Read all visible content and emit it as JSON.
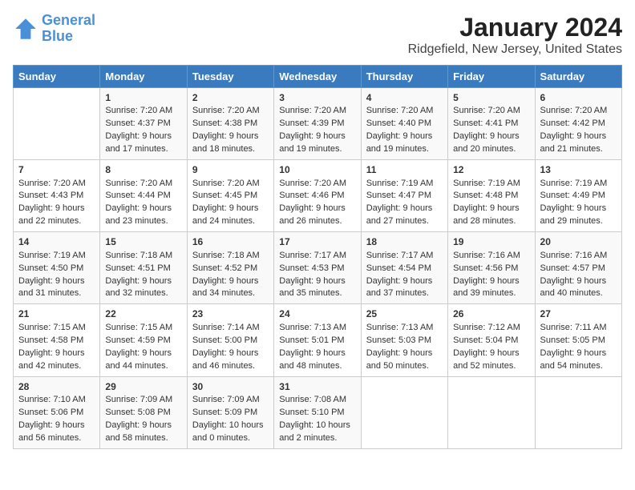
{
  "header": {
    "logo_line1": "General",
    "logo_line2": "Blue",
    "title": "January 2024",
    "subtitle": "Ridgefield, New Jersey, United States"
  },
  "days_of_week": [
    "Sunday",
    "Monday",
    "Tuesday",
    "Wednesday",
    "Thursday",
    "Friday",
    "Saturday"
  ],
  "weeks": [
    [
      {
        "num": "",
        "sunrise": "",
        "sunset": "",
        "daylight": ""
      },
      {
        "num": "1",
        "sunrise": "Sunrise: 7:20 AM",
        "sunset": "Sunset: 4:37 PM",
        "daylight": "Daylight: 9 hours and 17 minutes."
      },
      {
        "num": "2",
        "sunrise": "Sunrise: 7:20 AM",
        "sunset": "Sunset: 4:38 PM",
        "daylight": "Daylight: 9 hours and 18 minutes."
      },
      {
        "num": "3",
        "sunrise": "Sunrise: 7:20 AM",
        "sunset": "Sunset: 4:39 PM",
        "daylight": "Daylight: 9 hours and 19 minutes."
      },
      {
        "num": "4",
        "sunrise": "Sunrise: 7:20 AM",
        "sunset": "Sunset: 4:40 PM",
        "daylight": "Daylight: 9 hours and 19 minutes."
      },
      {
        "num": "5",
        "sunrise": "Sunrise: 7:20 AM",
        "sunset": "Sunset: 4:41 PM",
        "daylight": "Daylight: 9 hours and 20 minutes."
      },
      {
        "num": "6",
        "sunrise": "Sunrise: 7:20 AM",
        "sunset": "Sunset: 4:42 PM",
        "daylight": "Daylight: 9 hours and 21 minutes."
      }
    ],
    [
      {
        "num": "7",
        "sunrise": "Sunrise: 7:20 AM",
        "sunset": "Sunset: 4:43 PM",
        "daylight": "Daylight: 9 hours and 22 minutes."
      },
      {
        "num": "8",
        "sunrise": "Sunrise: 7:20 AM",
        "sunset": "Sunset: 4:44 PM",
        "daylight": "Daylight: 9 hours and 23 minutes."
      },
      {
        "num": "9",
        "sunrise": "Sunrise: 7:20 AM",
        "sunset": "Sunset: 4:45 PM",
        "daylight": "Daylight: 9 hours and 24 minutes."
      },
      {
        "num": "10",
        "sunrise": "Sunrise: 7:20 AM",
        "sunset": "Sunset: 4:46 PM",
        "daylight": "Daylight: 9 hours and 26 minutes."
      },
      {
        "num": "11",
        "sunrise": "Sunrise: 7:19 AM",
        "sunset": "Sunset: 4:47 PM",
        "daylight": "Daylight: 9 hours and 27 minutes."
      },
      {
        "num": "12",
        "sunrise": "Sunrise: 7:19 AM",
        "sunset": "Sunset: 4:48 PM",
        "daylight": "Daylight: 9 hours and 28 minutes."
      },
      {
        "num": "13",
        "sunrise": "Sunrise: 7:19 AM",
        "sunset": "Sunset: 4:49 PM",
        "daylight": "Daylight: 9 hours and 29 minutes."
      }
    ],
    [
      {
        "num": "14",
        "sunrise": "Sunrise: 7:19 AM",
        "sunset": "Sunset: 4:50 PM",
        "daylight": "Daylight: 9 hours and 31 minutes."
      },
      {
        "num": "15",
        "sunrise": "Sunrise: 7:18 AM",
        "sunset": "Sunset: 4:51 PM",
        "daylight": "Daylight: 9 hours and 32 minutes."
      },
      {
        "num": "16",
        "sunrise": "Sunrise: 7:18 AM",
        "sunset": "Sunset: 4:52 PM",
        "daylight": "Daylight: 9 hours and 34 minutes."
      },
      {
        "num": "17",
        "sunrise": "Sunrise: 7:17 AM",
        "sunset": "Sunset: 4:53 PM",
        "daylight": "Daylight: 9 hours and 35 minutes."
      },
      {
        "num": "18",
        "sunrise": "Sunrise: 7:17 AM",
        "sunset": "Sunset: 4:54 PM",
        "daylight": "Daylight: 9 hours and 37 minutes."
      },
      {
        "num": "19",
        "sunrise": "Sunrise: 7:16 AM",
        "sunset": "Sunset: 4:56 PM",
        "daylight": "Daylight: 9 hours and 39 minutes."
      },
      {
        "num": "20",
        "sunrise": "Sunrise: 7:16 AM",
        "sunset": "Sunset: 4:57 PM",
        "daylight": "Daylight: 9 hours and 40 minutes."
      }
    ],
    [
      {
        "num": "21",
        "sunrise": "Sunrise: 7:15 AM",
        "sunset": "Sunset: 4:58 PM",
        "daylight": "Daylight: 9 hours and 42 minutes."
      },
      {
        "num": "22",
        "sunrise": "Sunrise: 7:15 AM",
        "sunset": "Sunset: 4:59 PM",
        "daylight": "Daylight: 9 hours and 44 minutes."
      },
      {
        "num": "23",
        "sunrise": "Sunrise: 7:14 AM",
        "sunset": "Sunset: 5:00 PM",
        "daylight": "Daylight: 9 hours and 46 minutes."
      },
      {
        "num": "24",
        "sunrise": "Sunrise: 7:13 AM",
        "sunset": "Sunset: 5:01 PM",
        "daylight": "Daylight: 9 hours and 48 minutes."
      },
      {
        "num": "25",
        "sunrise": "Sunrise: 7:13 AM",
        "sunset": "Sunset: 5:03 PM",
        "daylight": "Daylight: 9 hours and 50 minutes."
      },
      {
        "num": "26",
        "sunrise": "Sunrise: 7:12 AM",
        "sunset": "Sunset: 5:04 PM",
        "daylight": "Daylight: 9 hours and 52 minutes."
      },
      {
        "num": "27",
        "sunrise": "Sunrise: 7:11 AM",
        "sunset": "Sunset: 5:05 PM",
        "daylight": "Daylight: 9 hours and 54 minutes."
      }
    ],
    [
      {
        "num": "28",
        "sunrise": "Sunrise: 7:10 AM",
        "sunset": "Sunset: 5:06 PM",
        "daylight": "Daylight: 9 hours and 56 minutes."
      },
      {
        "num": "29",
        "sunrise": "Sunrise: 7:09 AM",
        "sunset": "Sunset: 5:08 PM",
        "daylight": "Daylight: 9 hours and 58 minutes."
      },
      {
        "num": "30",
        "sunrise": "Sunrise: 7:09 AM",
        "sunset": "Sunset: 5:09 PM",
        "daylight": "Daylight: 10 hours and 0 minutes."
      },
      {
        "num": "31",
        "sunrise": "Sunrise: 7:08 AM",
        "sunset": "Sunset: 5:10 PM",
        "daylight": "Daylight: 10 hours and 2 minutes."
      },
      {
        "num": "",
        "sunrise": "",
        "sunset": "",
        "daylight": ""
      },
      {
        "num": "",
        "sunrise": "",
        "sunset": "",
        "daylight": ""
      },
      {
        "num": "",
        "sunrise": "",
        "sunset": "",
        "daylight": ""
      }
    ]
  ]
}
